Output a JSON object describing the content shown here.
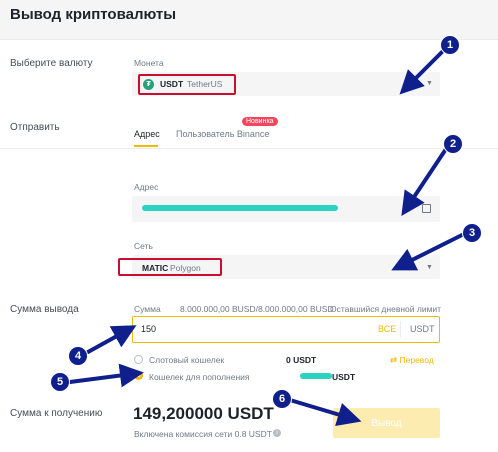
{
  "page": {
    "title": "Вывод криптовалюты"
  },
  "currency": {
    "section_label": "Выберите валюту",
    "field_label": "Монета",
    "code": "USDT",
    "name": "TetherUS"
  },
  "send": {
    "section_label": "Отправить",
    "tabs": [
      {
        "label": "Адрес"
      },
      {
        "label": "Пользователь Binance"
      }
    ],
    "new_badge": "Новинка",
    "address_label": "Адрес",
    "network_label": "Сеть",
    "network_code": "MATIC",
    "network_name": "Polygon"
  },
  "amount": {
    "section_label": "Сумма вывода",
    "field_label": "Сумма",
    "limit": "8.000.000,00 BUSD/8.000.000,00 BUSD",
    "limit_note": "Оставшийся дневной лимит",
    "value": "150",
    "all_label": "ВСЕ",
    "currency": "USDT"
  },
  "wallets": [
    {
      "label": "Слотовый кошелек",
      "balance": "0 USDT",
      "selected": false
    },
    {
      "label": "Кошелек для пополнения",
      "balance": "USDT",
      "selected": true
    }
  ],
  "transfer_label": "Перевод",
  "receive": {
    "section_label": "Сумма к получению",
    "amount": "149,200000 USDT",
    "fee_note": "Включена комиссия сети 0.8 USDT"
  },
  "withdraw_button": "Вывод",
  "markers": [
    "1",
    "2",
    "3",
    "4",
    "5",
    "6"
  ],
  "colors": {
    "accent": "#f0b90b",
    "annotation": "#0f1f8c",
    "highlight": "#c8102e",
    "tether": "#26a17b",
    "masked": "#2ad3c0"
  }
}
